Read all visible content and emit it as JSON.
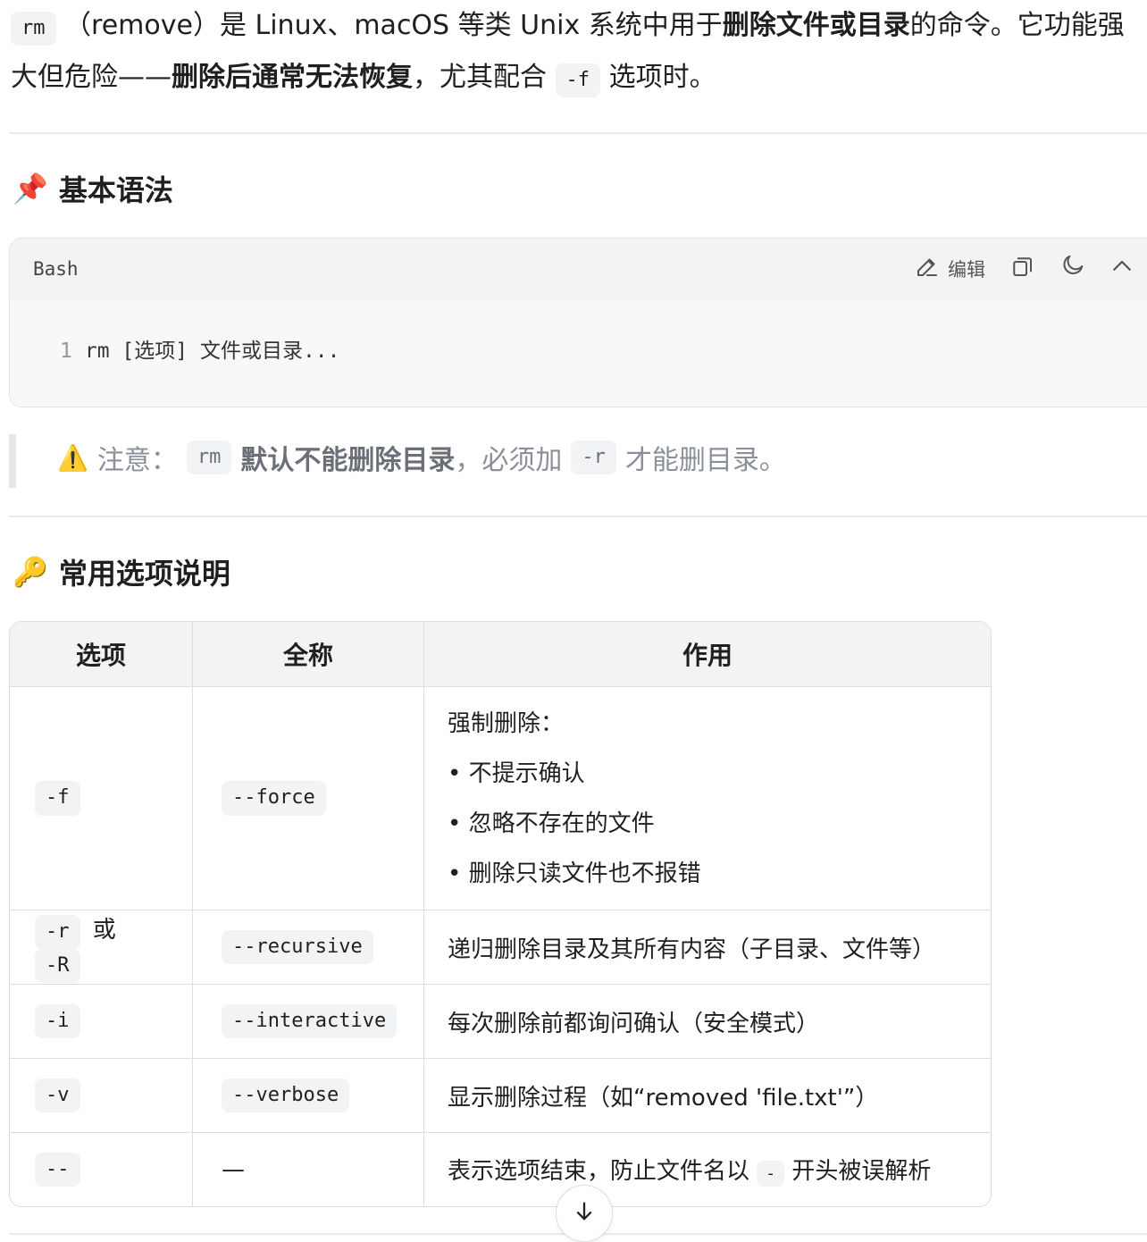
{
  "intro": {
    "line1_code": "rm",
    "line1_text": "（remove）是 Linux、macOS 等类 Unix 系统中用于",
    "line1_bold": "删除文件或目录",
    "line1_tail": "的命令。它功能强",
    "line2_start": "大但危险——",
    "line2_bold": "删除后通常无法恢复",
    "line2_mid": "，尤其配合",
    "line2_code": "-f",
    "line2_tail": "选项时。"
  },
  "section1": {
    "emoji": "📌",
    "title": "基本语法"
  },
  "codeblock": {
    "lang": "Bash",
    "edit_label": "编辑",
    "line_number": "1",
    "code": "rm [选项] 文件或目录..."
  },
  "note": {
    "emoji": "⚠️",
    "prefix": "注意：",
    "code1": "rm",
    "bold": "默认不能删除目录",
    "mid": "，必须加",
    "code2": "-r",
    "tail": "才能删目录。"
  },
  "section2": {
    "emoji": "🔑",
    "title": "常用选项说明"
  },
  "table": {
    "headers": [
      "选项",
      "全称",
      "作用"
    ],
    "rows": [
      {
        "opt": "-f",
        "full": "--force",
        "desc_title": "强制删除：",
        "bullets": [
          "• 不提示确认",
          "• 忽略不存在的文件",
          "• 删除只读文件也不报错"
        ]
      },
      {
        "opt": "-r",
        "opt_or": "或",
        "opt2": "-R",
        "full": "--recursive",
        "desc": "递归删除目录及其所有内容（子目录、文件等）"
      },
      {
        "opt": "-i",
        "full": "--interactive",
        "desc": "每次删除前都询问确认（安全模式）"
      },
      {
        "opt": "-v",
        "full": "--verbose",
        "desc": "显示删除过程（如“removed 'file.txt'”）"
      },
      {
        "opt": "--",
        "full": "—",
        "desc_pre": "表示选项结束，防止文件名以",
        "desc_code": "-",
        "desc_post": "开头被误解析"
      }
    ]
  }
}
